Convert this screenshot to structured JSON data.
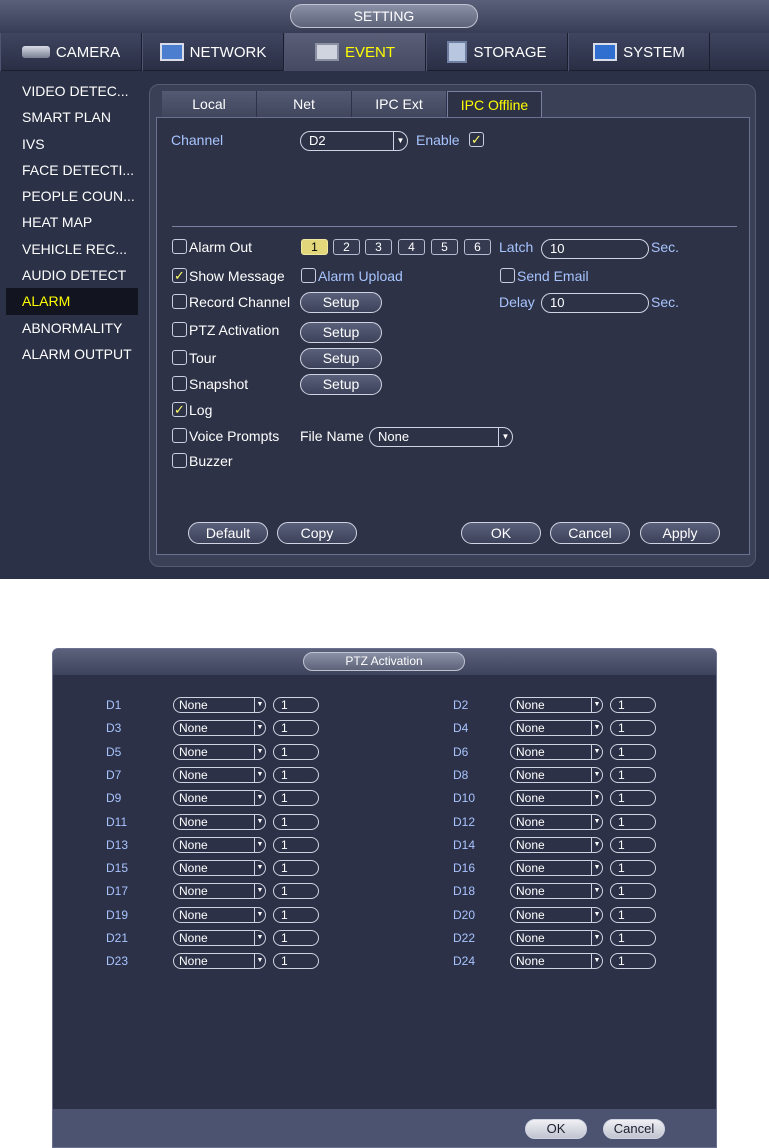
{
  "title_bar": {
    "title": "SETTING"
  },
  "top_nav": [
    {
      "label": "CAMERA",
      "icon": "camera-icon",
      "active": false
    },
    {
      "label": "NETWORK",
      "icon": "network-icon",
      "active": false
    },
    {
      "label": "EVENT",
      "icon": "event-icon",
      "active": true
    },
    {
      "label": "STORAGE",
      "icon": "storage-icon",
      "active": false
    },
    {
      "label": "SYSTEM",
      "icon": "system-icon",
      "active": false
    }
  ],
  "sidebar": {
    "items": [
      {
        "label": "VIDEO DETEC..."
      },
      {
        "label": "SMART PLAN"
      },
      {
        "label": "IVS"
      },
      {
        "label": "FACE DETECTI..."
      },
      {
        "label": "PEOPLE COUN..."
      },
      {
        "label": "HEAT MAP"
      },
      {
        "label": "VEHICLE REC..."
      },
      {
        "label": "AUDIO DETECT"
      },
      {
        "label": "ALARM",
        "active": true
      },
      {
        "label": "ABNORMALITY"
      },
      {
        "label": "ALARM OUTPUT"
      }
    ]
  },
  "subtabs": [
    {
      "label": "Local"
    },
    {
      "label": "Net"
    },
    {
      "label": "IPC Ext"
    },
    {
      "label": "IPC Offline",
      "active": true
    }
  ],
  "form": {
    "channel_label": "Channel",
    "channel_value": "D2",
    "enable_label": "Enable",
    "enable_checked": true,
    "alarm_out_label": "Alarm Out",
    "alarm_out_checked": false,
    "alarm_out_channels": [
      "1",
      "2",
      "3",
      "4",
      "5",
      "6"
    ],
    "alarm_out_selected": "1",
    "latch_label": "Latch",
    "latch_value": "10",
    "latch_unit": "Sec.",
    "show_message_label": "Show Message",
    "show_message_checked": true,
    "alarm_upload_label": "Alarm Upload",
    "alarm_upload_checked": false,
    "send_email_label": "Send Email",
    "send_email_checked": false,
    "record_channel_label": "Record Channel",
    "record_channel_checked": false,
    "delay_label": "Delay",
    "delay_value": "10",
    "delay_unit": "Sec.",
    "ptz_activation_label": "PTZ Activation",
    "ptz_activation_checked": false,
    "tour_label": "Tour",
    "tour_checked": false,
    "snapshot_label": "Snapshot",
    "snapshot_checked": false,
    "log_label": "Log",
    "log_checked": true,
    "voice_prompts_label": "Voice Prompts",
    "voice_prompts_checked": false,
    "file_name_label": "File Name",
    "file_name_value": "None",
    "buzzer_label": "Buzzer",
    "buzzer_checked": false,
    "setup_label": "Setup",
    "default_label": "Default",
    "copy_label": "Copy",
    "ok_label": "OK",
    "cancel_label": "Cancel",
    "apply_label": "Apply"
  },
  "ptz_dialog": {
    "title": "PTZ Activation",
    "left_channels": [
      {
        "channel": "D1",
        "type": "None",
        "value": "1"
      },
      {
        "channel": "D3",
        "type": "None",
        "value": "1"
      },
      {
        "channel": "D5",
        "type": "None",
        "value": "1"
      },
      {
        "channel": "D7",
        "type": "None",
        "value": "1"
      },
      {
        "channel": "D9",
        "type": "None",
        "value": "1"
      },
      {
        "channel": "D11",
        "type": "None",
        "value": "1"
      },
      {
        "channel": "D13",
        "type": "None",
        "value": "1"
      },
      {
        "channel": "D15",
        "type": "None",
        "value": "1"
      },
      {
        "channel": "D17",
        "type": "None",
        "value": "1"
      },
      {
        "channel": "D19",
        "type": "None",
        "value": "1"
      },
      {
        "channel": "D21",
        "type": "None",
        "value": "1"
      },
      {
        "channel": "D23",
        "type": "None",
        "value": "1"
      }
    ],
    "right_channels": [
      {
        "channel": "D2",
        "type": "None",
        "value": "1"
      },
      {
        "channel": "D4",
        "type": "None",
        "value": "1"
      },
      {
        "channel": "D6",
        "type": "None",
        "value": "1"
      },
      {
        "channel": "D8",
        "type": "None",
        "value": "1"
      },
      {
        "channel": "D10",
        "type": "None",
        "value": "1"
      },
      {
        "channel": "D12",
        "type": "None",
        "value": "1"
      },
      {
        "channel": "D14",
        "type": "None",
        "value": "1"
      },
      {
        "channel": "D16",
        "type": "None",
        "value": "1"
      },
      {
        "channel": "D18",
        "type": "None",
        "value": "1"
      },
      {
        "channel": "D20",
        "type": "None",
        "value": "1"
      },
      {
        "channel": "D22",
        "type": "None",
        "value": "1"
      },
      {
        "channel": "D24",
        "type": "None",
        "value": "1"
      }
    ],
    "ok_label": "OK",
    "cancel_label": "Cancel"
  }
}
